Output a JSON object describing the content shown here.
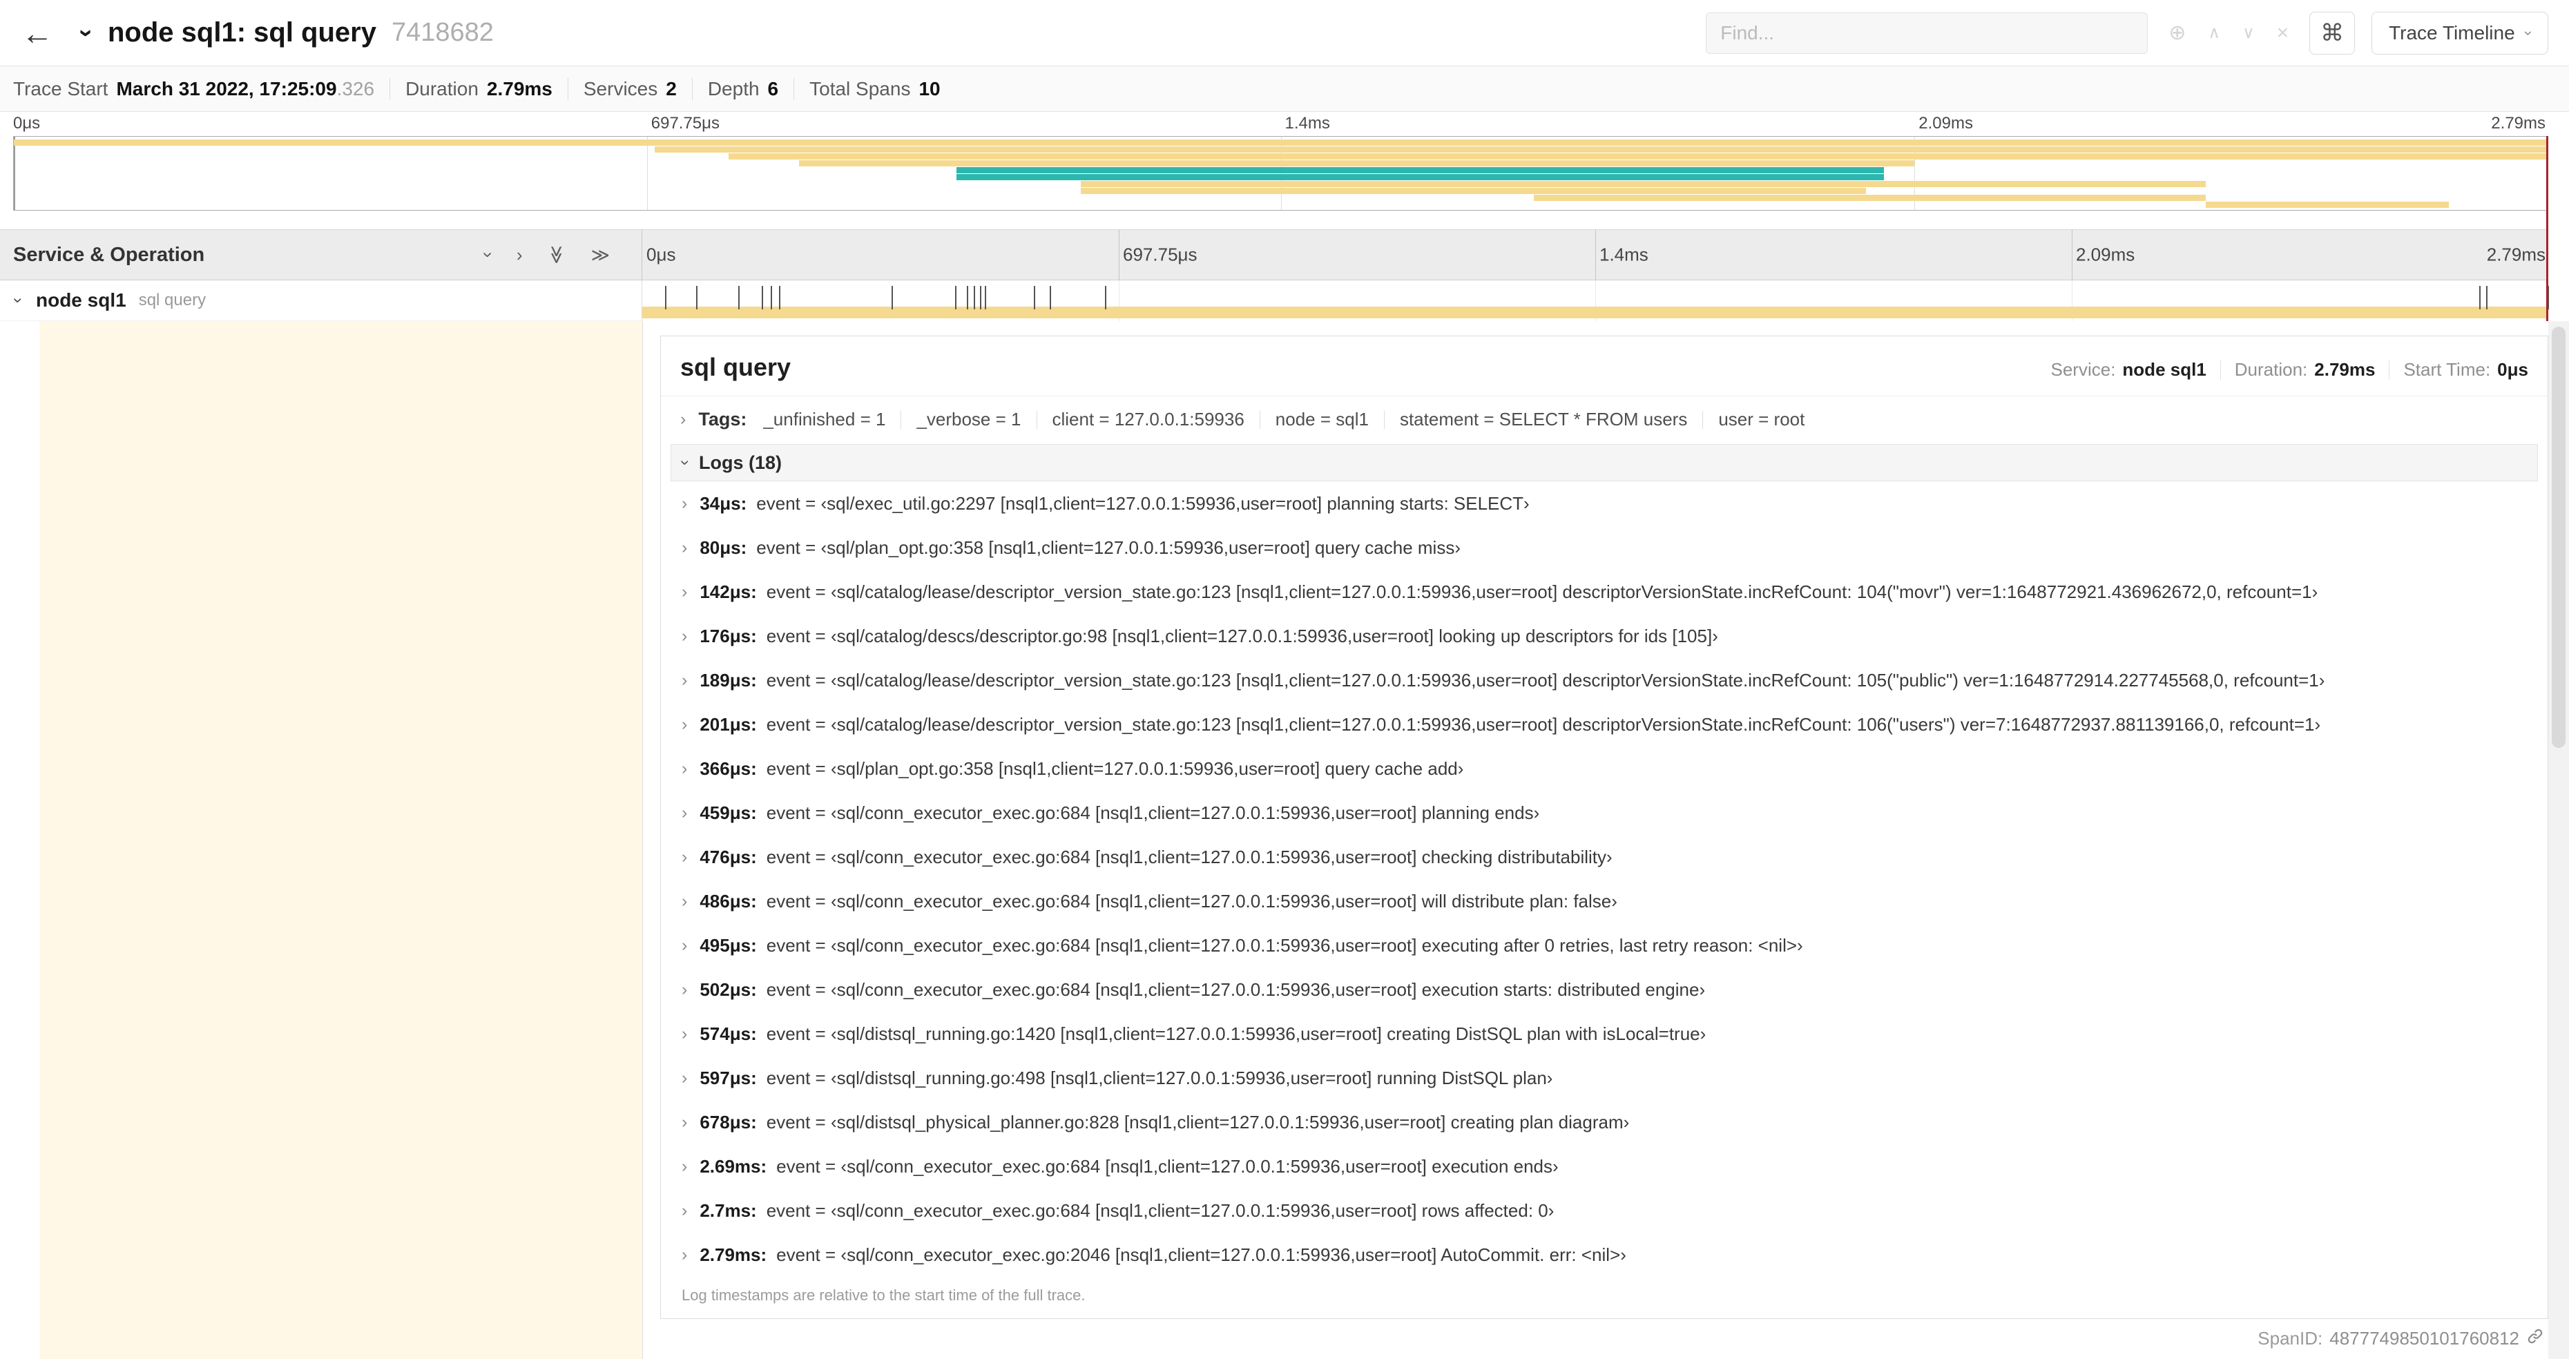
{
  "colors": {
    "tan": "#F5D98E",
    "teal": "#2BB7AD",
    "cream": "#FFF8E6",
    "red": "#A6242B"
  },
  "icons": {
    "back": "←",
    "chevron": "›",
    "double_chevron": "≫",
    "locate": "⊕",
    "prev": "∧",
    "next": "∨",
    "clear": "×",
    "command": "⌘"
  },
  "header": {
    "title": "node sql1: sql query",
    "trace_id": "7418682",
    "find_placeholder": "Find...",
    "trace_timeline_label": "Trace Timeline"
  },
  "summary": {
    "items": [
      {
        "label": "Trace Start",
        "value": "March 31 2022, 17:25:09",
        "suffix": ".326"
      },
      {
        "label": "Duration",
        "value": "2.79ms"
      },
      {
        "label": "Services",
        "value": "2"
      },
      {
        "label": "Depth",
        "value": "6"
      },
      {
        "label": "Total Spans",
        "value": "10"
      }
    ]
  },
  "minimap": {
    "ticks": [
      "0μs",
      "697.75μs",
      "1.4ms",
      "2.09ms",
      "2.79ms"
    ],
    "spans": [
      {
        "left": 0,
        "width": 100,
        "color": "tan"
      },
      {
        "left": 25.3,
        "width": 74.7,
        "color": "tan"
      },
      {
        "left": 28.2,
        "width": 71.8,
        "color": "tan"
      },
      {
        "left": 31.0,
        "width": 44.0,
        "color": "tan"
      },
      {
        "left": 37.2,
        "width": 36.6,
        "color": "teal"
      },
      {
        "left": 37.2,
        "width": 36.6,
        "color": "teal"
      },
      {
        "left": 42.1,
        "width": 44.4,
        "color": "tan"
      },
      {
        "left": 42.1,
        "width": 31.0,
        "color": "tan"
      },
      {
        "left": 60.0,
        "width": 26.5,
        "color": "tan"
      },
      {
        "left": 86.5,
        "width": 9.6,
        "color": "tan"
      }
    ]
  },
  "timeline": {
    "left_header": "Service & Operation",
    "ticks": [
      "0μs",
      "697.75μs",
      "1.4ms",
      "2.09ms",
      "2.79ms"
    ],
    "row": {
      "service": "node sql1",
      "operation": "sql query"
    },
    "total_us": 2790,
    "log_marks_us": [
      34,
      80,
      142,
      176,
      189,
      201,
      366,
      459,
      476,
      486,
      495,
      502,
      574,
      597,
      678,
      2690,
      2700,
      2790
    ]
  },
  "detail": {
    "title": "sql query",
    "meta": {
      "service_label": "Service:",
      "service_value": "node sql1",
      "duration_label": "Duration:",
      "duration_value": "2.79ms",
      "start_label": "Start Time:",
      "start_value": "0μs"
    },
    "tags_label": "Tags:",
    "tags": [
      {
        "key": "_unfinished",
        "value": "1"
      },
      {
        "key": "_verbose",
        "value": "1"
      },
      {
        "key": "client",
        "value": "127.0.0.1:59936"
      },
      {
        "key": "node",
        "value": "sql1"
      },
      {
        "key": "statement",
        "value": "SELECT * FROM users"
      },
      {
        "key": "user",
        "value": "root"
      }
    ],
    "logs_label": "Logs (18)",
    "logs": [
      {
        "time": "34μs:",
        "message": "event = ‹sql/exec_util.go:2297 [nsql1,client=127.0.0.1:59936,user=root] planning starts: SELECT›"
      },
      {
        "time": "80μs:",
        "message": "event = ‹sql/plan_opt.go:358 [nsql1,client=127.0.0.1:59936,user=root] query cache miss›"
      },
      {
        "time": "142μs:",
        "message": "event = ‹sql/catalog/lease/descriptor_version_state.go:123 [nsql1,client=127.0.0.1:59936,user=root] descriptorVersionState.incRefCount: 104(\"movr\") ver=1:1648772921.436962672,0, refcount=1›"
      },
      {
        "time": "176μs:",
        "message": "event = ‹sql/catalog/descs/descriptor.go:98 [nsql1,client=127.0.0.1:59936,user=root] looking up descriptors for ids [105]›"
      },
      {
        "time": "189μs:",
        "message": "event = ‹sql/catalog/lease/descriptor_version_state.go:123 [nsql1,client=127.0.0.1:59936,user=root] descriptorVersionState.incRefCount: 105(\"public\") ver=1:1648772914.227745568,0, refcount=1›"
      },
      {
        "time": "201μs:",
        "message": "event = ‹sql/catalog/lease/descriptor_version_state.go:123 [nsql1,client=127.0.0.1:59936,user=root] descriptorVersionState.incRefCount: 106(\"users\") ver=7:1648772937.881139166,0, refcount=1›"
      },
      {
        "time": "366μs:",
        "message": "event = ‹sql/plan_opt.go:358 [nsql1,client=127.0.0.1:59936,user=root] query cache add›"
      },
      {
        "time": "459μs:",
        "message": "event = ‹sql/conn_executor_exec.go:684 [nsql1,client=127.0.0.1:59936,user=root] planning ends›"
      },
      {
        "time": "476μs:",
        "message": "event = ‹sql/conn_executor_exec.go:684 [nsql1,client=127.0.0.1:59936,user=root] checking distributability›"
      },
      {
        "time": "486μs:",
        "message": "event = ‹sql/conn_executor_exec.go:684 [nsql1,client=127.0.0.1:59936,user=root] will distribute plan: false›"
      },
      {
        "time": "495μs:",
        "message": "event = ‹sql/conn_executor_exec.go:684 [nsql1,client=127.0.0.1:59936,user=root] executing after 0 retries, last retry reason: <nil>›"
      },
      {
        "time": "502μs:",
        "message": "event = ‹sql/conn_executor_exec.go:684 [nsql1,client=127.0.0.1:59936,user=root] execution starts: distributed engine›"
      },
      {
        "time": "574μs:",
        "message": "event = ‹sql/distsql_running.go:1420 [nsql1,client=127.0.0.1:59936,user=root] creating DistSQL plan with isLocal=true›"
      },
      {
        "time": "597μs:",
        "message": "event = ‹sql/distsql_running.go:498 [nsql1,client=127.0.0.1:59936,user=root] running DistSQL plan›"
      },
      {
        "time": "678μs:",
        "message": "event = ‹sql/distsql_physical_planner.go:828 [nsql1,client=127.0.0.1:59936,user=root] creating plan diagram›"
      },
      {
        "time": "2.69ms:",
        "message": "event = ‹sql/conn_executor_exec.go:684 [nsql1,client=127.0.0.1:59936,user=root] execution ends›"
      },
      {
        "time": "2.7ms:",
        "message": "event = ‹sql/conn_executor_exec.go:684 [nsql1,client=127.0.0.1:59936,user=root] rows affected: 0›"
      },
      {
        "time": "2.79ms:",
        "message": "event = ‹sql/conn_executor_exec.go:2046 [nsql1,client=127.0.0.1:59936,user=root] AutoCommit. err: <nil>›"
      }
    ],
    "logs_footnote": "Log timestamps are relative to the start time of the full trace.",
    "span_id_label": "SpanID:",
    "span_id": "4877749850101760812"
  }
}
